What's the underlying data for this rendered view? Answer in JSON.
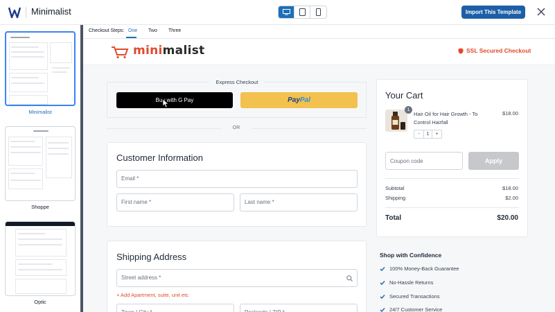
{
  "app": {
    "name": "Minimalist",
    "import_button": "Import This Template",
    "device_modes": [
      "desktop-icon",
      "tablet-icon",
      "mobile-icon"
    ],
    "active_device": "desktop"
  },
  "sidebar": {
    "templates": [
      {
        "label": "Minimalist",
        "selected": true
      },
      {
        "label": "Shoppe",
        "selected": false
      },
      {
        "label": "Optic",
        "selected": false
      }
    ]
  },
  "steps": {
    "label": "Checkout Steps:",
    "items": [
      "One",
      "Two",
      "Three"
    ],
    "active": "One"
  },
  "store": {
    "logo_prefix": "mini",
    "logo_suffix": "malist",
    "ssl_text": "SSL Secured Checkout"
  },
  "express": {
    "title": "Express Checkout",
    "gpay_label": "Buy with G Pay",
    "paypal_a": "Pay",
    "paypal_b": "Pal",
    "or_text": "OR"
  },
  "customer": {
    "title": "Customer Information",
    "email_placeholder": "Email *",
    "first_name_placeholder": "First name *",
    "last_name_placeholder": "Last name *"
  },
  "shipping": {
    "title": "Shipping Address",
    "street_placeholder": "Street address *",
    "add_apartment": "+ Add Apartment, suite, unit etc",
    "town_placeholder": "Town / City *",
    "postcode_placeholder": "Postcode / ZIP *"
  },
  "cart": {
    "title": "Your Cart",
    "product_name": "Hair Oil for Hair Growth - To Control Hairfall",
    "product_price": "$18.00",
    "badge_qty": "1",
    "stepper_minus": "-",
    "stepper_value": "1",
    "stepper_plus": "+",
    "coupon_placeholder": "Coupon code",
    "apply_label": "Apply",
    "subtotal_label": "Subtotal",
    "subtotal_value": "$18.00",
    "shipping_label": "Shipping",
    "shipping_value": "$2.00",
    "total_label": "Total",
    "total_value": "$20.00"
  },
  "confidence": {
    "title": "Shop with Confidence",
    "items": [
      "100% Money-Back Guarantee",
      "No-Hassle Returns",
      "Secured Transactions",
      "24/7 Customer Service"
    ]
  },
  "colors": {
    "brand_orange": "#e04a2c",
    "primary_blue": "#1d5fa7",
    "paypal_yellow": "#f2c14e",
    "check_blue": "#1d6fb8"
  }
}
